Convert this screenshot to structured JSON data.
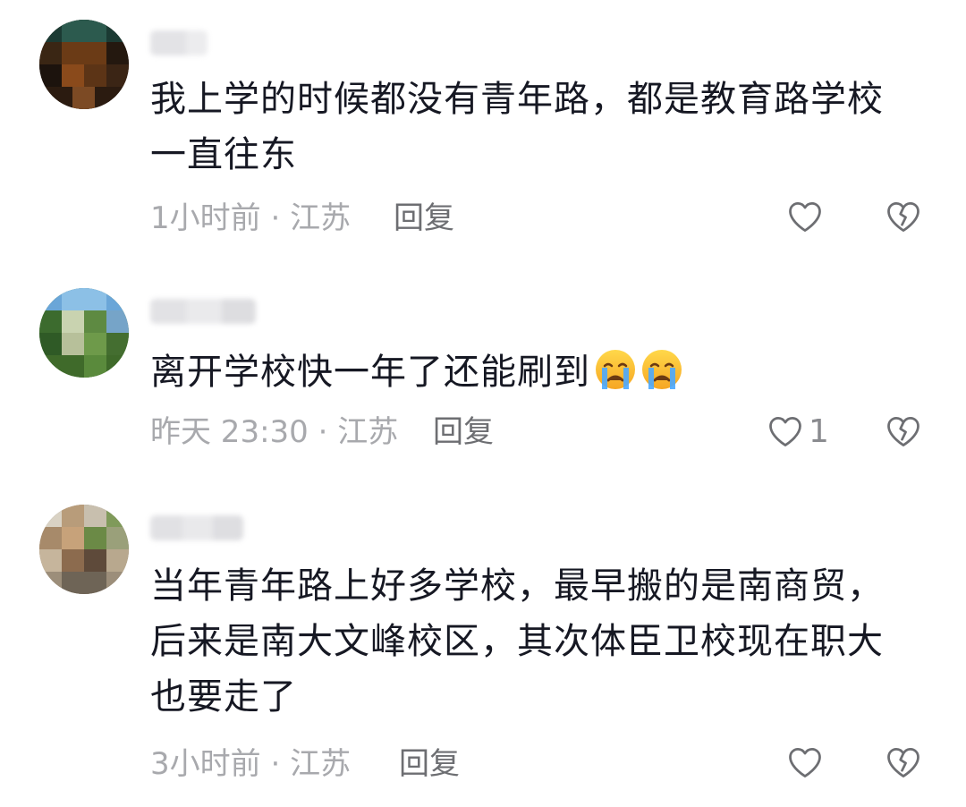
{
  "comments": [
    {
      "text": "我上学的时候都没有青年路，都是教育路学校一直往东",
      "time": "1小时前",
      "location": "江苏",
      "reply_label": "回复",
      "like_count": ""
    },
    {
      "text": "离开学校快一年了还能刷到",
      "time": "昨天 23:30",
      "location": "江苏",
      "reply_label": "回复",
      "like_count": "1",
      "emojis": [
        "crying-face",
        "crying-face"
      ]
    },
    {
      "text": "当年青年路上好多学校，最早搬的是南商贸，后来是南大文峰校区，其次体臣卫校现在职大也要走了",
      "time": "3小时前",
      "location": "江苏",
      "reply_label": "回复",
      "like_count": ""
    }
  ],
  "separator": " · ",
  "colors": {
    "text": "#161823",
    "meta": "#a8a9ad",
    "reply": "#6d6e72",
    "icon": "#6d6e72"
  },
  "icons": {
    "like": "heart-outline-icon",
    "dislike": "broken-heart-outline-icon",
    "emoji": "crying-face-emoji"
  }
}
